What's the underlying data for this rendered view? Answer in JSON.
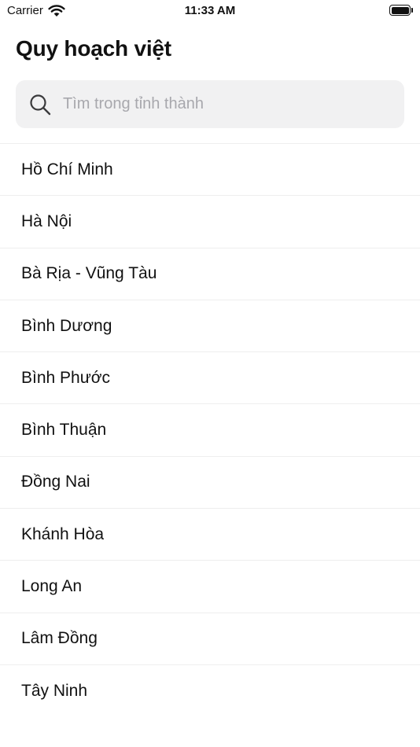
{
  "status_bar": {
    "carrier": "Carrier",
    "time": "11:33 AM",
    "icons": [
      "wifi-icon",
      "battery-icon"
    ]
  },
  "header": {
    "title": "Quy hoạch việt"
  },
  "search": {
    "placeholder": "Tìm trong tỉnh thành",
    "value": "",
    "icon": "search-icon"
  },
  "provinces": [
    "Hồ Chí Minh",
    "Hà Nội",
    "Bà Rịa - Vũng Tàu",
    "Bình Dương",
    "Bình Phước",
    "Bình Thuận",
    "Đồng Nai",
    "Khánh Hòa",
    "Long An",
    "Lâm Đồng",
    "Tây Ninh"
  ],
  "colors": {
    "text": "#111111",
    "placeholder": "#a8a8ad",
    "search_bg": "#f1f1f2",
    "divider": "#eeeeee"
  }
}
